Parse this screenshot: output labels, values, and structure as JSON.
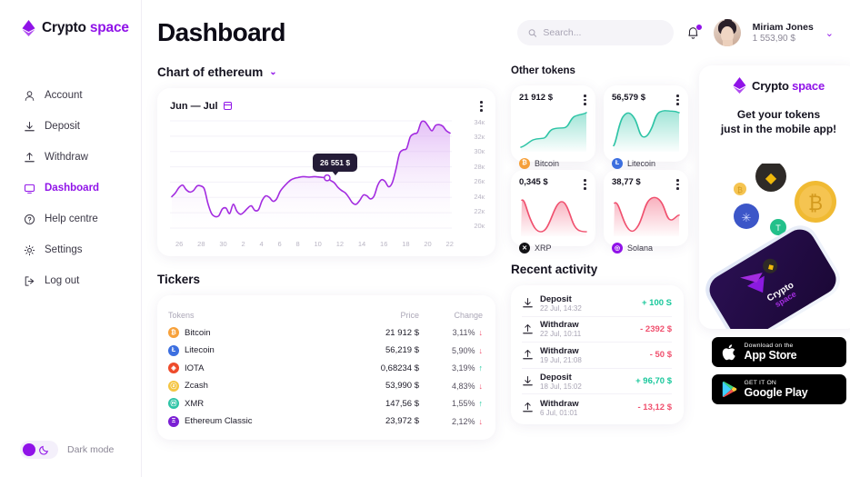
{
  "brand": {
    "name": "Crypto",
    "accent": "space",
    "accent_color": "#9013e8"
  },
  "sidebar": {
    "items": [
      {
        "label": "Account",
        "icon": "user-icon",
        "active": false
      },
      {
        "label": "Deposit",
        "icon": "download-icon",
        "active": false
      },
      {
        "label": "Withdraw",
        "icon": "upload-icon",
        "active": false
      },
      {
        "label": "Dashboard",
        "icon": "monitor-icon",
        "active": true
      },
      {
        "label": "Help centre",
        "icon": "question-icon",
        "active": false
      },
      {
        "label": "Settings",
        "icon": "gear-icon",
        "active": false
      },
      {
        "label": "Log out",
        "icon": "logout-icon",
        "active": false
      }
    ],
    "dark_mode_label": "Dark mode"
  },
  "header": {
    "title": "Dashboard",
    "search_placeholder": "Search...",
    "search_value": "",
    "user_name": "Miriam Jones",
    "user_balance": "1 553,90 $"
  },
  "chart_panel": {
    "title": "Chart of ethereum",
    "range_label": "Jun — Jul",
    "tooltip_value": "26 551 $"
  },
  "chart_data": {
    "type": "area",
    "title": "Chart of ethereum",
    "subtitle": "Jun — Jul",
    "xlabel": "",
    "ylabel": "",
    "ylim": [
      20000,
      34000
    ],
    "ytick_labels": [
      "34к",
      "32к",
      "30к",
      "28к",
      "26к",
      "24к",
      "22к",
      "20к"
    ],
    "ytick_values": [
      34000,
      32000,
      30000,
      28000,
      26000,
      24000,
      22000,
      20000
    ],
    "xtick_labels": [
      "26",
      "28",
      "30",
      "2",
      "4",
      "6",
      "8",
      "10",
      "12",
      "14",
      "16",
      "18",
      "20",
      "22"
    ],
    "grid": true,
    "legend": "none",
    "line_color": "#a32ce0",
    "fill_gradient": [
      "#cf8ef0",
      "#ffffff"
    ],
    "annotation": {
      "label": "26 551 $",
      "x": 10.5,
      "y": 26551
    },
    "series": [
      {
        "name": "ETH",
        "x": [
          26.0,
          26.3,
          26.6,
          27.0,
          27.3,
          27.6,
          28.0,
          28.3,
          28.6,
          29.0,
          29.3,
          29.6,
          30.0,
          30.3,
          30.6,
          1.0,
          1.3,
          1.6,
          2.0,
          2.3,
          2.6,
          3.0,
          3.3,
          3.6,
          4.0,
          4.3,
          4.6,
          5.0,
          5.3,
          5.6,
          6.0,
          6.3,
          6.6,
          7.0,
          7.3,
          7.6,
          8.0,
          8.3,
          8.6,
          9.0,
          9.3,
          9.6,
          10.0,
          10.5,
          11.0,
          11.3,
          11.6,
          12.0,
          12.3,
          12.6,
          13.0,
          13.3,
          13.6,
          14.0,
          14.3,
          14.6,
          15.0,
          15.3,
          15.6,
          16.0,
          16.3,
          16.6,
          17.0,
          17.3,
          17.6,
          18.0,
          18.3,
          18.6,
          19.0,
          19.3,
          19.6,
          20.0,
          20.3,
          20.6,
          21.0,
          21.3,
          21.6,
          22.0
        ],
        "y": [
          24100,
          24600,
          25300,
          25600,
          25000,
          24700,
          24900,
          25500,
          25500,
          25100,
          23200,
          21900,
          21500,
          21600,
          22500,
          22600,
          21900,
          23100,
          22200,
          21800,
          22100,
          22600,
          22900,
          22300,
          22400,
          23600,
          24200,
          24000,
          23500,
          23800,
          24800,
          25400,
          25900,
          26300,
          26500,
          26600,
          26700,
          26700,
          26650,
          26700,
          26700,
          26650,
          26600,
          26551,
          26200,
          25900,
          25300,
          24900,
          24600,
          24000,
          23300,
          23100,
          23600,
          24300,
          24200,
          23800,
          24200,
          25600,
          26300,
          26100,
          25400,
          25900,
          27600,
          29700,
          30200,
          30400,
          31900,
          32300,
          32500,
          33800,
          33900,
          33300,
          32700,
          33400,
          33500,
          33300,
          32700,
          32400
        ]
      }
    ]
  },
  "other_tokens": {
    "title": "Other tokens",
    "cards": [
      {
        "price": "21 912 $",
        "name": "Bitcoin",
        "symbol": "₿",
        "coin_color": "#f7a13b",
        "trend": "up",
        "trend_color": "#2ec4a6"
      },
      {
        "price": "56,579 $",
        "name": "Litecoin",
        "symbol": "Ł",
        "coin_color": "#3c6fe0",
        "trend": "up",
        "trend_color": "#2ec4a6"
      },
      {
        "price": "0,345 $",
        "name": "XRP",
        "symbol": "✕",
        "coin_color": "#131316",
        "trend": "down",
        "trend_color": "#f0506e"
      },
      {
        "price": "38,77 $",
        "name": "Solana",
        "symbol": "◎",
        "coin_color": "#9013e8",
        "trend": "down",
        "trend_color": "#f0506e"
      }
    ]
  },
  "tickers": {
    "title": "Tickers",
    "columns": [
      "Tokens",
      "Price",
      "Change"
    ],
    "rows": [
      {
        "name": "Bitcoin",
        "symbol": "₿",
        "coin_color": "#f7a13b",
        "price": "21 912 $",
        "change": "3,11%",
        "dir": "down"
      },
      {
        "name": "Litecoin",
        "symbol": "Ł",
        "coin_color": "#3c6fe0",
        "price": "56,219 $",
        "change": "5,90%",
        "dir": "down"
      },
      {
        "name": "IOTA",
        "symbol": "◈",
        "coin_color": "#ee4b2b",
        "price": "0,68234 $",
        "change": "3,19%",
        "dir": "up"
      },
      {
        "name": "Zcash",
        "symbol": "ⓩ",
        "coin_color": "#f4c542",
        "price": "53,990 $",
        "change": "4,83%",
        "dir": "down"
      },
      {
        "name": "XMR",
        "symbol": "ⓜ",
        "coin_color": "#2ec4a6",
        "price": "147,56 $",
        "change": "1,55%",
        "dir": "up"
      },
      {
        "name": "Ethereum Classic",
        "symbol": "Ξ",
        "coin_color": "#7b1fd4",
        "price": "23,972 $",
        "change": "2,12%",
        "dir": "down"
      }
    ]
  },
  "activity": {
    "title": "Recent activity",
    "rows": [
      {
        "type": "Deposit",
        "icon": "download-icon",
        "date": "22 Jul, 14:32",
        "amount": "+ 100 S",
        "sign": "pos"
      },
      {
        "type": "Withdraw",
        "icon": "upload-icon",
        "date": "22 Jul, 10:11",
        "amount": "- 2392 $",
        "sign": "neg"
      },
      {
        "type": "Withdraw",
        "icon": "upload-icon",
        "date": "19 Jul, 21:08",
        "amount": "- 50 $",
        "sign": "neg"
      },
      {
        "type": "Deposit",
        "icon": "download-icon",
        "date": "18 Jul, 15:02",
        "amount": "+ 96,70 $",
        "sign": "pos"
      },
      {
        "type": "Withdraw",
        "icon": "upload-icon",
        "date": "6 Jul, 01:01",
        "amount": "- 13,12 $",
        "sign": "neg"
      }
    ]
  },
  "promo": {
    "brand_name": "Crypto",
    "brand_accent": "space",
    "headline_line1": "Get your tokens",
    "headline_line2": "just in the mobile app!",
    "phone_label_1": "Crypto",
    "phone_label_2": "space",
    "appstore_small": "Download on the",
    "appstore_big": "App Store",
    "googleplay_small": "GET IT ON",
    "googleplay_big": "Google Play"
  }
}
